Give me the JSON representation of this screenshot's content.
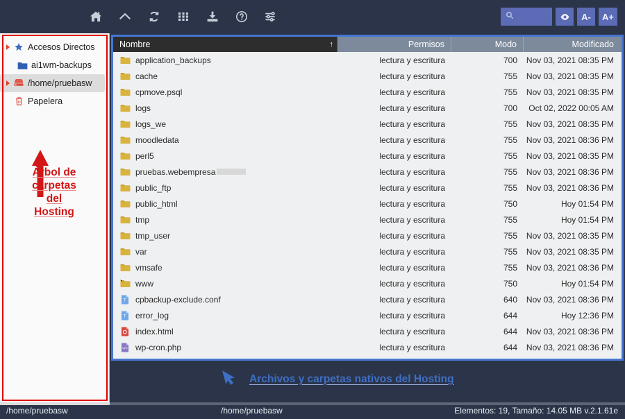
{
  "toolbar": {
    "icons": [
      {
        "name": "home-icon",
        "title": "Inicio"
      },
      {
        "name": "arrow-up-icon",
        "title": "Subir"
      },
      {
        "name": "refresh-icon",
        "title": "Recargar"
      },
      {
        "name": "grid-icon",
        "title": "Vista"
      },
      {
        "name": "download-icon",
        "title": "Descargar"
      },
      {
        "name": "help-icon",
        "title": "Ayuda"
      },
      {
        "name": "settings-sliders-icon",
        "title": "Ajustes"
      }
    ],
    "search": {
      "placeholder": "",
      "value": "",
      "icon": "search-icon"
    },
    "buttons": [
      {
        "name": "eye-toggle-button",
        "label": "◉"
      },
      {
        "name": "font-decrease-button",
        "label": "A-"
      },
      {
        "name": "font-increase-button",
        "label": "A+"
      }
    ],
    "accent_color": "#5b6bb5",
    "bg_color": "#2b3449"
  },
  "sidebar": {
    "items": [
      {
        "label": "Accesos Directos",
        "icon": "star-icon",
        "expander": true,
        "indent": false,
        "selected": false
      },
      {
        "label": "ai1wm-backups",
        "icon": "folder-icon",
        "expander": false,
        "indent": true,
        "selected": false
      },
      {
        "label": "/home/pruebasw",
        "icon": "drive-icon",
        "expander": true,
        "indent": false,
        "selected": true
      },
      {
        "label": "Papelera",
        "icon": "trash-icon",
        "expander": false,
        "indent": false,
        "selected": false
      }
    ],
    "annotation": {
      "text": "Árbol de carpetas del Hosting",
      "lines": [
        "Árbol de",
        "carpetas",
        "del",
        "Hosting"
      ],
      "color": "#d31616",
      "arrow": "arrow-up-red"
    },
    "outline_color": "#e00000"
  },
  "file_pane": {
    "border_color": "#4676d0",
    "columns": [
      {
        "key": "nombre",
        "label": "Nombre",
        "sorted": true,
        "sort_indicator": "↑"
      },
      {
        "key": "permisos",
        "label": "Permisos"
      },
      {
        "key": "modo",
        "label": "Modo"
      },
      {
        "key": "modificado",
        "label": "Modificado"
      }
    ],
    "rows": [
      {
        "nombre": "application_backups",
        "icon": "folder-icon",
        "permisos": "lectura y escritura",
        "modo": "700",
        "modificado": "Nov 03, 2021 08:35 PM"
      },
      {
        "nombre": "cache",
        "icon": "folder-icon",
        "permisos": "lectura y escritura",
        "modo": "755",
        "modificado": "Nov 03, 2021 08:35 PM"
      },
      {
        "nombre": "cpmove.psql",
        "icon": "folder-icon",
        "permisos": "lectura y escritura",
        "modo": "755",
        "modificado": "Nov 03, 2021 08:35 PM"
      },
      {
        "nombre": "logs",
        "icon": "folder-icon",
        "permisos": "lectura y escritura",
        "modo": "700",
        "modificado": "Oct 02, 2022 00:05 AM"
      },
      {
        "nombre": "logs_we",
        "icon": "folder-icon",
        "permisos": "lectura y escritura",
        "modo": "755",
        "modificado": "Nov 03, 2021 08:35 PM"
      },
      {
        "nombre": "moodledata",
        "icon": "folder-icon",
        "permisos": "lectura y escritura",
        "modo": "755",
        "modificado": "Nov 03, 2021 08:36 PM"
      },
      {
        "nombre": "perl5",
        "icon": "folder-icon",
        "permisos": "lectura y escritura",
        "modo": "755",
        "modificado": "Nov 03, 2021 08:35 PM"
      },
      {
        "nombre": "pruebas.webempresa",
        "icon": "folder-icon",
        "redacted": true,
        "permisos": "lectura y escritura",
        "modo": "755",
        "modificado": "Nov 03, 2021 08:36 PM"
      },
      {
        "nombre": "public_ftp",
        "icon": "folder-icon",
        "permisos": "lectura y escritura",
        "modo": "755",
        "modificado": "Nov 03, 2021 08:36 PM"
      },
      {
        "nombre": "public_html",
        "icon": "folder-icon",
        "permisos": "lectura y escritura",
        "modo": "750",
        "modificado": "Hoy 01:54 PM"
      },
      {
        "nombre": "tmp",
        "icon": "folder-icon",
        "permisos": "lectura y escritura",
        "modo": "755",
        "modificado": "Hoy 01:54 PM"
      },
      {
        "nombre": "tmp_user",
        "icon": "folder-icon",
        "permisos": "lectura y escritura",
        "modo": "755",
        "modificado": "Nov 03, 2021 08:35 PM"
      },
      {
        "nombre": "var",
        "icon": "folder-icon",
        "permisos": "lectura y escritura",
        "modo": "755",
        "modificado": "Nov 03, 2021 08:35 PM"
      },
      {
        "nombre": "vmsafe",
        "icon": "folder-icon",
        "permisos": "lectura y escritura",
        "modo": "755",
        "modificado": "Nov 03, 2021 08:36 PM"
      },
      {
        "nombre": "www",
        "icon": "folder-link-icon",
        "permisos": "lectura y escritura",
        "modo": "750",
        "modificado": "Hoy 01:54 PM"
      },
      {
        "nombre": "cpbackup-exclude.conf",
        "icon": "text-file-icon",
        "permisos": "lectura y escritura",
        "modo": "640",
        "modificado": "Nov 03, 2021 08:36 PM"
      },
      {
        "nombre": "error_log",
        "icon": "text-file-icon",
        "permisos": "lectura y escritura",
        "modo": "644",
        "modificado": "Hoy 12:36 PM"
      },
      {
        "nombre": "index.html",
        "icon": "html-file-icon",
        "permisos": "lectura y escritura",
        "modo": "644",
        "modificado": "Nov 03, 2021 08:36 PM"
      },
      {
        "nombre": "wp-cron.php",
        "icon": "php-file-icon",
        "permisos": "lectura y escritura",
        "modo": "644",
        "modificado": "Nov 03, 2021 08:36 PM"
      }
    ],
    "annotation": {
      "text": "Archivos y carpetas nativos del Hosting",
      "color": "#3f6fc4",
      "arrow": "arrow-up-left-blue"
    }
  },
  "statusbar": {
    "path_left": "/home/pruebasw",
    "path_center": "/home/pruebasw",
    "info": "Elementos: 19, Tamaño: 14.05 MB v.2.1.61e"
  }
}
